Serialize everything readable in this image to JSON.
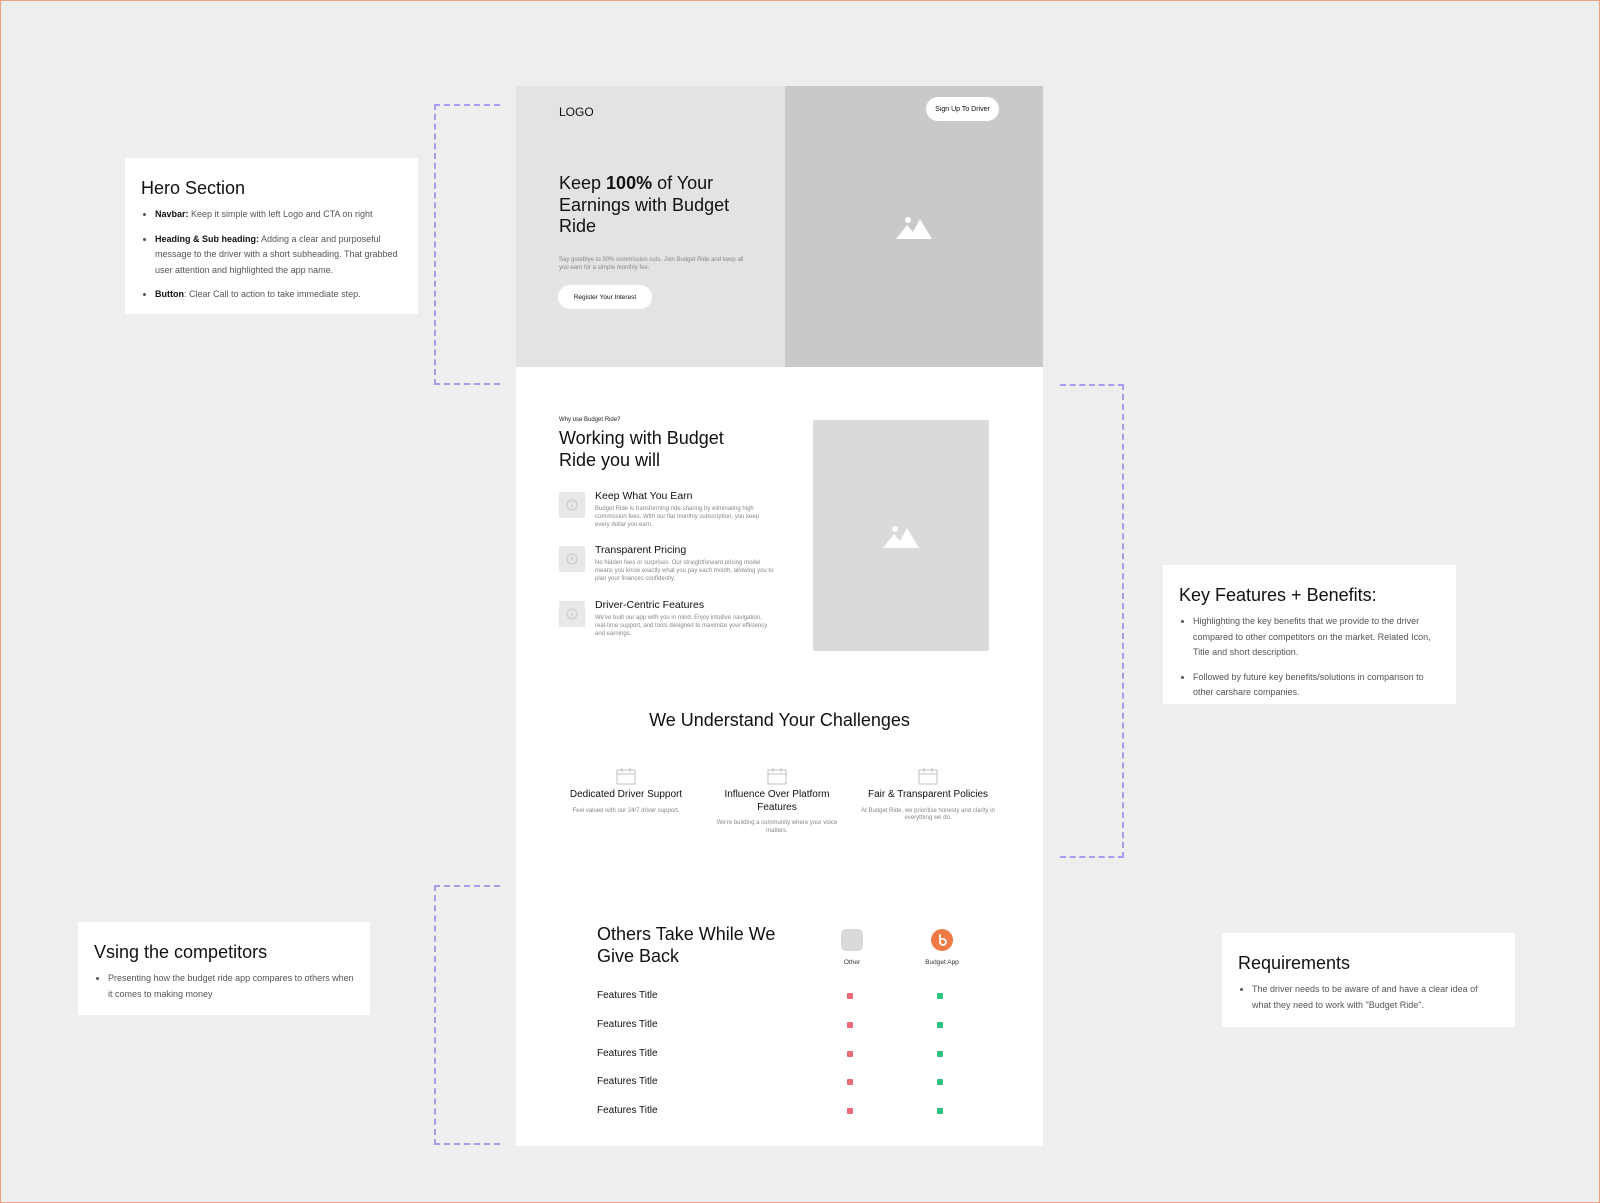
{
  "annotations": {
    "hero": {
      "title": "Hero Section",
      "items": [
        {
          "bold": "Navbar:",
          "text": " Keep it simple with left Logo and CTA on right"
        },
        {
          "bold": "Heading & Sub heading:",
          "text": " Adding a clear and purposeful message to the driver with a short subheading. That grabbed user attention and highlighted the app name."
        },
        {
          "bold": "Button",
          "text": ": Clear Call to action to take immediate step."
        }
      ]
    },
    "features": {
      "title": "Key Features + Benefits:",
      "items": [
        "Highlighting the key benefits that we provide to the driver compared to other competitors on the market. Related Icon, Title and short description.",
        "Followed by future key benefits/solutions in comparison to other carshare companies."
      ]
    },
    "competitors": {
      "title": "Vsing the competitors",
      "items": [
        "Presenting how the budget ride app compares to others when it comes to making money"
      ]
    },
    "requirements": {
      "title": "Requirements",
      "items": [
        "The driver needs to be aware of and have a clear idea of what they need to work with \"Budget Ride\"."
      ]
    }
  },
  "hero": {
    "logo": "LOGO",
    "cta_nav": "Sign Up To Driver",
    "title_pre": "Keep ",
    "title_bold": "100%",
    "title_post": " of Your Earnings with Budget Ride",
    "subtitle": "Say goodbye to 30% commission cuts. Join Budget Ride and keep all you earn for a simple monthly fee.",
    "cta": "Register Your Interest"
  },
  "why": {
    "eyebrow": "Why use Budget Ride?",
    "title": "Working with Budget Ride you will",
    "features": [
      {
        "title": "Keep What You Earn",
        "desc": "Budget Ride is transforming ride-sharing by eliminating high commission fees. With our flat monthly subscription, you keep every dollar you earn."
      },
      {
        "title": "Transparent Pricing",
        "desc": "No hidden fees or surprises. Our straightforward pricing model means you know exactly what you pay each month, allowing you to plan your finances confidently."
      },
      {
        "title": "Driver-Centric Features",
        "desc": "We've built our app with you in mind. Enjoy intuitive navigation, real-time support, and tools designed to maximize your efficiency and earnings."
      }
    ]
  },
  "challenges": {
    "title": "We Understand Your Challenges",
    "items": [
      {
        "title": "Dedicated Driver Support",
        "desc": "Feel valued with our 24/7 driver support."
      },
      {
        "title": "Influence Over Platform Features",
        "desc": "We're building a community where your voice matters."
      },
      {
        "title": "Fair & Transparent Policies",
        "desc": "At Budget Ride, we prioritise honesty and clarity in everything we do."
      }
    ]
  },
  "comparison": {
    "title": "Others Take While We Give Back",
    "columns": [
      {
        "label": "Other",
        "color": "#d9d9d9"
      },
      {
        "label": "Budget App",
        "color": "#f07a45"
      }
    ],
    "rows": [
      {
        "label": "Features Title",
        "other": false,
        "budget": true
      },
      {
        "label": "Features Title",
        "other": false,
        "budget": true
      },
      {
        "label": "Features Title",
        "other": false,
        "budget": true
      },
      {
        "label": "Features Title",
        "other": false,
        "budget": true
      },
      {
        "label": "Features Title",
        "other": false,
        "budget": true
      }
    ]
  },
  "colors": {
    "background": "#eeeeee",
    "bracket": "#a79cf2",
    "cross": "#f06a7a",
    "check": "#2ec27e",
    "accent": "#f07a45"
  }
}
